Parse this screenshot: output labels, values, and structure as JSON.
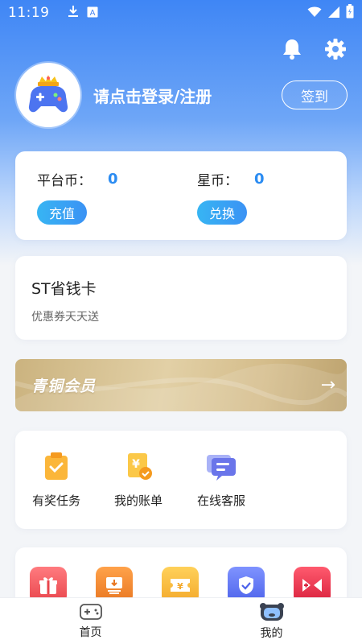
{
  "status": {
    "time": "11:19"
  },
  "profile": {
    "login_text": "请点击登录/注册",
    "signin_label": "签到"
  },
  "wallet": {
    "platform_label": "平台币：",
    "platform_value": "0",
    "recharge_label": "充值",
    "star_label": "星币：",
    "star_value": "0",
    "exchange_label": "兑换"
  },
  "savecard": {
    "title": "ST省钱卡",
    "subtitle": "优惠券天天送"
  },
  "vip": {
    "name": "青铜会员",
    "arrow": "→"
  },
  "services": [
    {
      "label": "有奖任务",
      "icon": "task-clipboard-icon"
    },
    {
      "label": "我的账单",
      "icon": "bill-icon"
    },
    {
      "label": "在线客服",
      "icon": "chat-icon"
    }
  ],
  "games": [
    {
      "icon": "gift-icon",
      "color": "#f0575c"
    },
    {
      "icon": "download-icon",
      "color": "#f08a2c"
    },
    {
      "icon": "coupon-icon",
      "color": "#f5b53a"
    },
    {
      "icon": "shield-icon",
      "color": "#5d74f0"
    },
    {
      "icon": "versus-icon",
      "color": "#e8334e"
    }
  ],
  "tabbar": [
    {
      "label": "首页",
      "icon": "gamepad-icon"
    },
    {
      "label": "我的",
      "icon": "profile-face-icon"
    }
  ],
  "colors": {
    "accent": "#2b8cf2",
    "hero_top": "#3f86f5"
  }
}
